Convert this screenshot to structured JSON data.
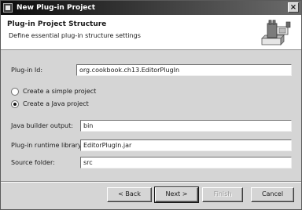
{
  "window": {
    "title": "New Plug-in Project",
    "close_glyph": "×"
  },
  "banner": {
    "heading": "Plug-in Project Structure",
    "description": "Define essential plug-in structure settings",
    "icon": "plugin-wizard-icon"
  },
  "form": {
    "plugin_id_label": "Plug-in Id:",
    "plugin_id_value": "org.cookbook.ch13.EditorPlugIn",
    "radio_simple_label": "Create a simple project",
    "radio_java_label": "Create a Java project",
    "selected_project_type": "java",
    "java_output_label": "Java builder output:",
    "java_output_value": "bin",
    "runtime_library_label": "Plug-in runtime library:",
    "runtime_library_value": "EditorPlugIn.jar",
    "source_folder_label": "Source folder:",
    "source_folder_value": "src"
  },
  "buttons": {
    "back": "< Back",
    "next": "Next >",
    "finish": "Finish",
    "cancel": "Cancel"
  }
}
